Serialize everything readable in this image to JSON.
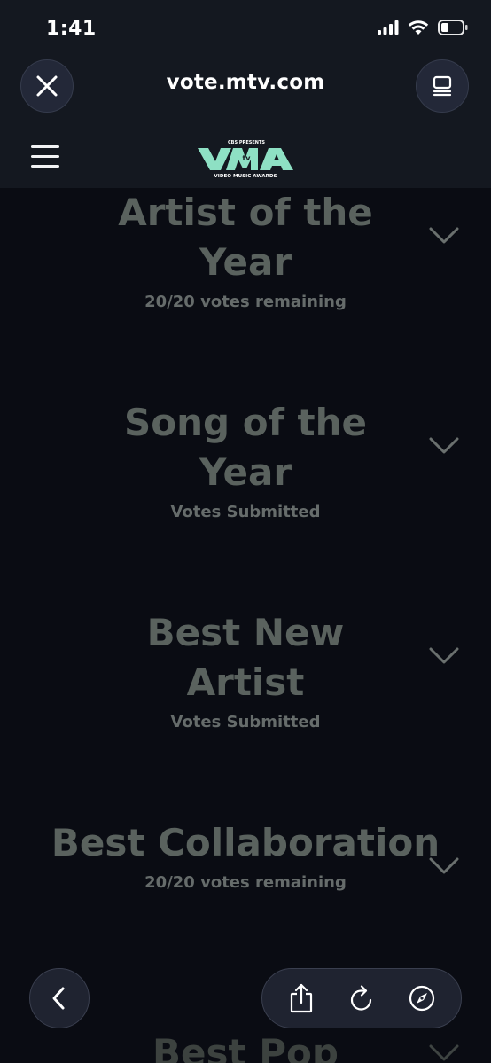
{
  "status_bar": {
    "time": "1:41"
  },
  "browser": {
    "url": "vote.mtv.com"
  },
  "logo": {
    "presenter": "CBS PRESENTS",
    "subtitle": "VIDEO MUSIC AWARDS",
    "accent_color": "#8ee0c4"
  },
  "categories": [
    {
      "title": "Artist of the Year",
      "status": "20/20 votes remaining"
    },
    {
      "title": "Song of the Year",
      "status": "Votes Submitted"
    },
    {
      "title": "Best New Artist",
      "status": "Votes Submitted"
    },
    {
      "title": "Best Collaboration",
      "status": "20/20 votes remaining"
    },
    {
      "title": "Best Pop",
      "status": ""
    }
  ],
  "icons": {
    "close": "close-icon",
    "tabs": "tabs-icon",
    "menu": "hamburger-menu-icon",
    "expand": "chevron-down-icon",
    "back": "chevron-left-icon",
    "share": "share-icon",
    "reload": "reload-icon",
    "safari": "compass-icon"
  },
  "colors": {
    "background": "#0a0c13",
    "header": "#141820",
    "category_text": "#5a625e"
  }
}
